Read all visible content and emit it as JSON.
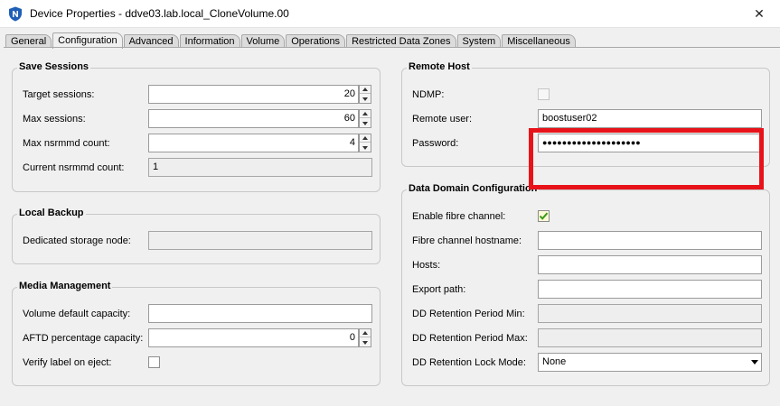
{
  "window": {
    "title": "Device Properties - ddve03.lab.local_CloneVolume.00",
    "app_icon": "networker-shield-icon",
    "close_glyph": "✕"
  },
  "tabs": [
    {
      "label": "General",
      "active": false
    },
    {
      "label": "Configuration",
      "active": true
    },
    {
      "label": "Advanced",
      "active": false
    },
    {
      "label": "Information",
      "active": false
    },
    {
      "label": "Volume",
      "active": false
    },
    {
      "label": "Operations",
      "active": false
    },
    {
      "label": "Restricted Data Zones",
      "active": false
    },
    {
      "label": "System",
      "active": false
    },
    {
      "label": "Miscellaneous",
      "active": false
    }
  ],
  "save_sessions": {
    "title": "Save Sessions",
    "target_sessions_label": "Target sessions:",
    "target_sessions_value": "20",
    "max_sessions_label": "Max sessions:",
    "max_sessions_value": "60",
    "max_nsrmmd_label": "Max nsrmmd count:",
    "max_nsrmmd_value": "4",
    "current_nsrmmd_label": "Current nsrmmd count:",
    "current_nsrmmd_value": "1"
  },
  "local_backup": {
    "title": "Local Backup",
    "dedicated_storage_node_label": "Dedicated storage node:",
    "dedicated_storage_node_value": ""
  },
  "media_management": {
    "title": "Media Management",
    "volume_default_capacity_label": "Volume default capacity:",
    "volume_default_capacity_value": "",
    "aftd_percentage_label": "AFTD percentage capacity:",
    "aftd_percentage_value": "0",
    "verify_label_label": "Verify label on eject:",
    "verify_label_checked": false
  },
  "remote_host": {
    "title": "Remote Host",
    "ndmp_label": "NDMP:",
    "ndmp_checked": false,
    "remote_user_label": "Remote user:",
    "remote_user_value": "boostuser02",
    "password_label": "Password:",
    "password_value": "●●●●●●●●●●●●●●●●●●●●"
  },
  "data_domain": {
    "title": "Data Domain Configuration",
    "enable_fc_label": "Enable fibre channel:",
    "enable_fc_checked": true,
    "fc_hostname_label": "Fibre channel hostname:",
    "fc_hostname_value": "",
    "hosts_label": "Hosts:",
    "hosts_value": "",
    "export_path_label": "Export path:",
    "export_path_value": "",
    "dd_retention_min_label": "DD Retention Period Min:",
    "dd_retention_min_value": "",
    "dd_retention_max_label": "DD Retention Period Max:",
    "dd_retention_max_value": "",
    "dd_retention_lock_label": "DD Retention Lock Mode:",
    "dd_retention_lock_value": "None"
  },
  "colors": {
    "highlight": "#e8131a",
    "icon_blue": "#1f5fb5",
    "check_green": "#3b9a1a"
  }
}
